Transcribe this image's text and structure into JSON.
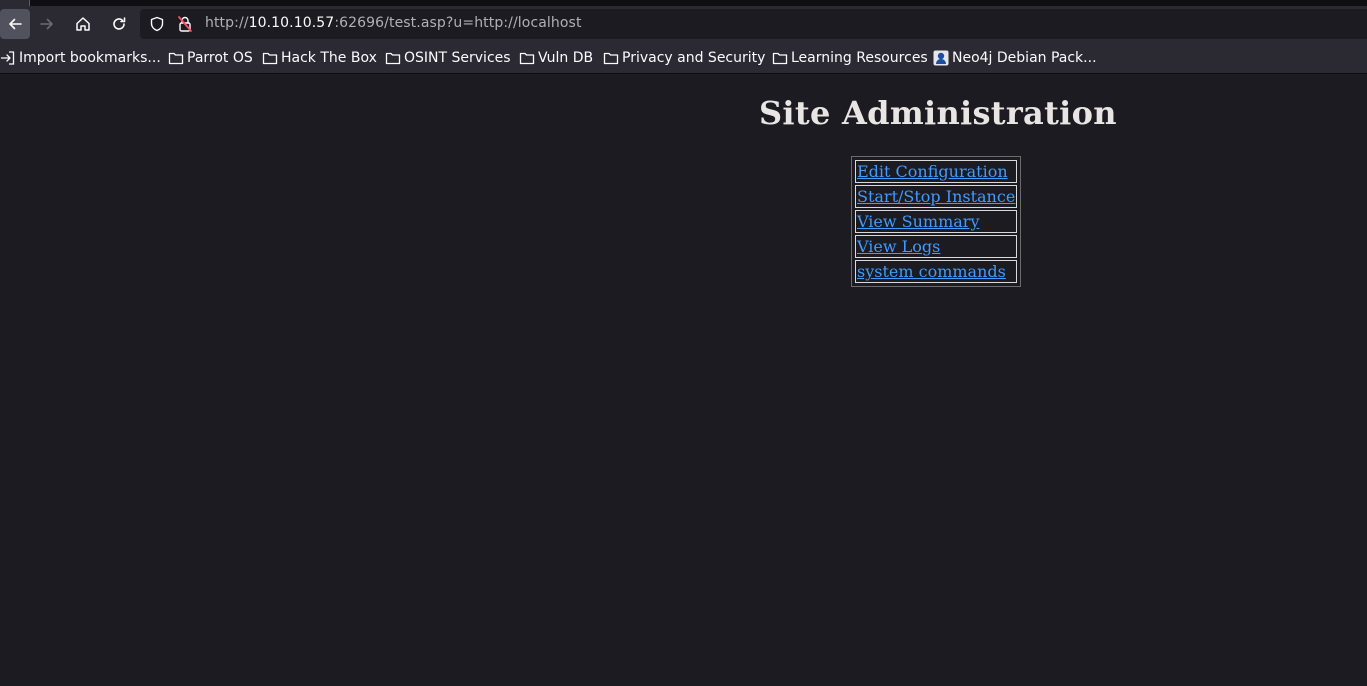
{
  "browser": {
    "url_prefix": "http://",
    "url_host": "10.10.10.57",
    "url_rest": ":62696/test.asp?u=http://localhost",
    "bookmarks": [
      {
        "label": "Import bookmarks...",
        "icon": "import-icon"
      },
      {
        "label": "Parrot OS",
        "icon": "folder-icon"
      },
      {
        "label": "Hack The Box",
        "icon": "folder-icon"
      },
      {
        "label": "OSINT Services",
        "icon": "folder-icon"
      },
      {
        "label": "Vuln DB",
        "icon": "folder-icon"
      },
      {
        "label": "Privacy and Security",
        "icon": "folder-icon"
      },
      {
        "label": "Learning Resources",
        "icon": "folder-icon"
      },
      {
        "label": "Neo4j Debian Pack...",
        "icon": "neo4j-icon"
      }
    ]
  },
  "page": {
    "title": "Site Administration",
    "links": [
      {
        "label": "Edit Configuration"
      },
      {
        "label": "Start/Stop Instance"
      },
      {
        "label": "View Summary"
      },
      {
        "label": "View Logs"
      },
      {
        "label": "system commands"
      }
    ]
  },
  "colors": {
    "page_background": "#1c1b22",
    "toolbar_background": "#2b2a33",
    "link": "#3f9bff",
    "title_text": "#e8e6e3"
  }
}
